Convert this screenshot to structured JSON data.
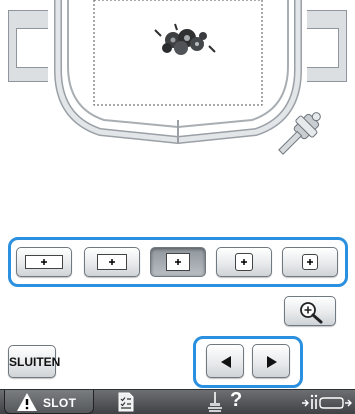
{
  "buttons": {
    "close_label": "SLUITEN"
  },
  "bottom_bar": {
    "slot_label": "SLOT",
    "question_glyph": "?"
  },
  "icons": {
    "zoom": "zoom-in-icon",
    "prev": "arrow-left-icon",
    "next": "arrow-right-icon",
    "warning": "warning-icon",
    "checklist": "checklist-icon",
    "thread": "thread-help-icon",
    "machine": "machine-settings-icon"
  },
  "hoop_sizes": {
    "selected_index": 2
  },
  "colors": {
    "highlight": "#2a90df",
    "bar": "#4e5053"
  }
}
